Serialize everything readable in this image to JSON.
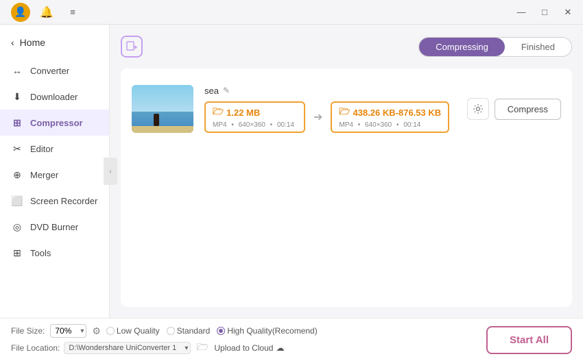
{
  "titlebar": {
    "controls": {
      "minimize": "—",
      "maximize": "□",
      "close": "✕"
    },
    "hamburger": "≡"
  },
  "sidebar": {
    "home_label": "Home",
    "items": [
      {
        "id": "converter",
        "label": "Converter",
        "icon": "↔"
      },
      {
        "id": "downloader",
        "label": "Downloader",
        "icon": "⬇"
      },
      {
        "id": "compressor",
        "label": "Compressor",
        "icon": "⊞",
        "active": true
      },
      {
        "id": "editor",
        "label": "Editor",
        "icon": "✂"
      },
      {
        "id": "merger",
        "label": "Merger",
        "icon": "⊕"
      },
      {
        "id": "screen-recorder",
        "label": "Screen Recorder",
        "icon": "⬜"
      },
      {
        "id": "dvd-burner",
        "label": "DVD Burner",
        "icon": "◎"
      },
      {
        "id": "tools",
        "label": "Tools",
        "icon": "⊞"
      }
    ]
  },
  "tabs": {
    "compressing": "Compressing",
    "finished": "Finished",
    "active": "compressing"
  },
  "file": {
    "name": "sea",
    "original_size": "1.22 MB",
    "compressed_size": "438.26 KB-876.53 KB",
    "format": "MP4",
    "resolution": "640×360",
    "duration": "00:14",
    "folder_icon": "🗁",
    "compress_btn": "Compress"
  },
  "bottom": {
    "file_size_label": "File Size:",
    "file_size_value": "70%",
    "quality_options": [
      {
        "label": "Low Quality",
        "checked": false
      },
      {
        "label": "Standard",
        "checked": false
      },
      {
        "label": "High Quality(Recomend)",
        "checked": true
      }
    ],
    "file_location_label": "File Location:",
    "file_location_path": "D:\\Wondershare UniConverter 1",
    "upload_cloud_label": "Upload to Cloud",
    "start_all_label": "Start All"
  }
}
